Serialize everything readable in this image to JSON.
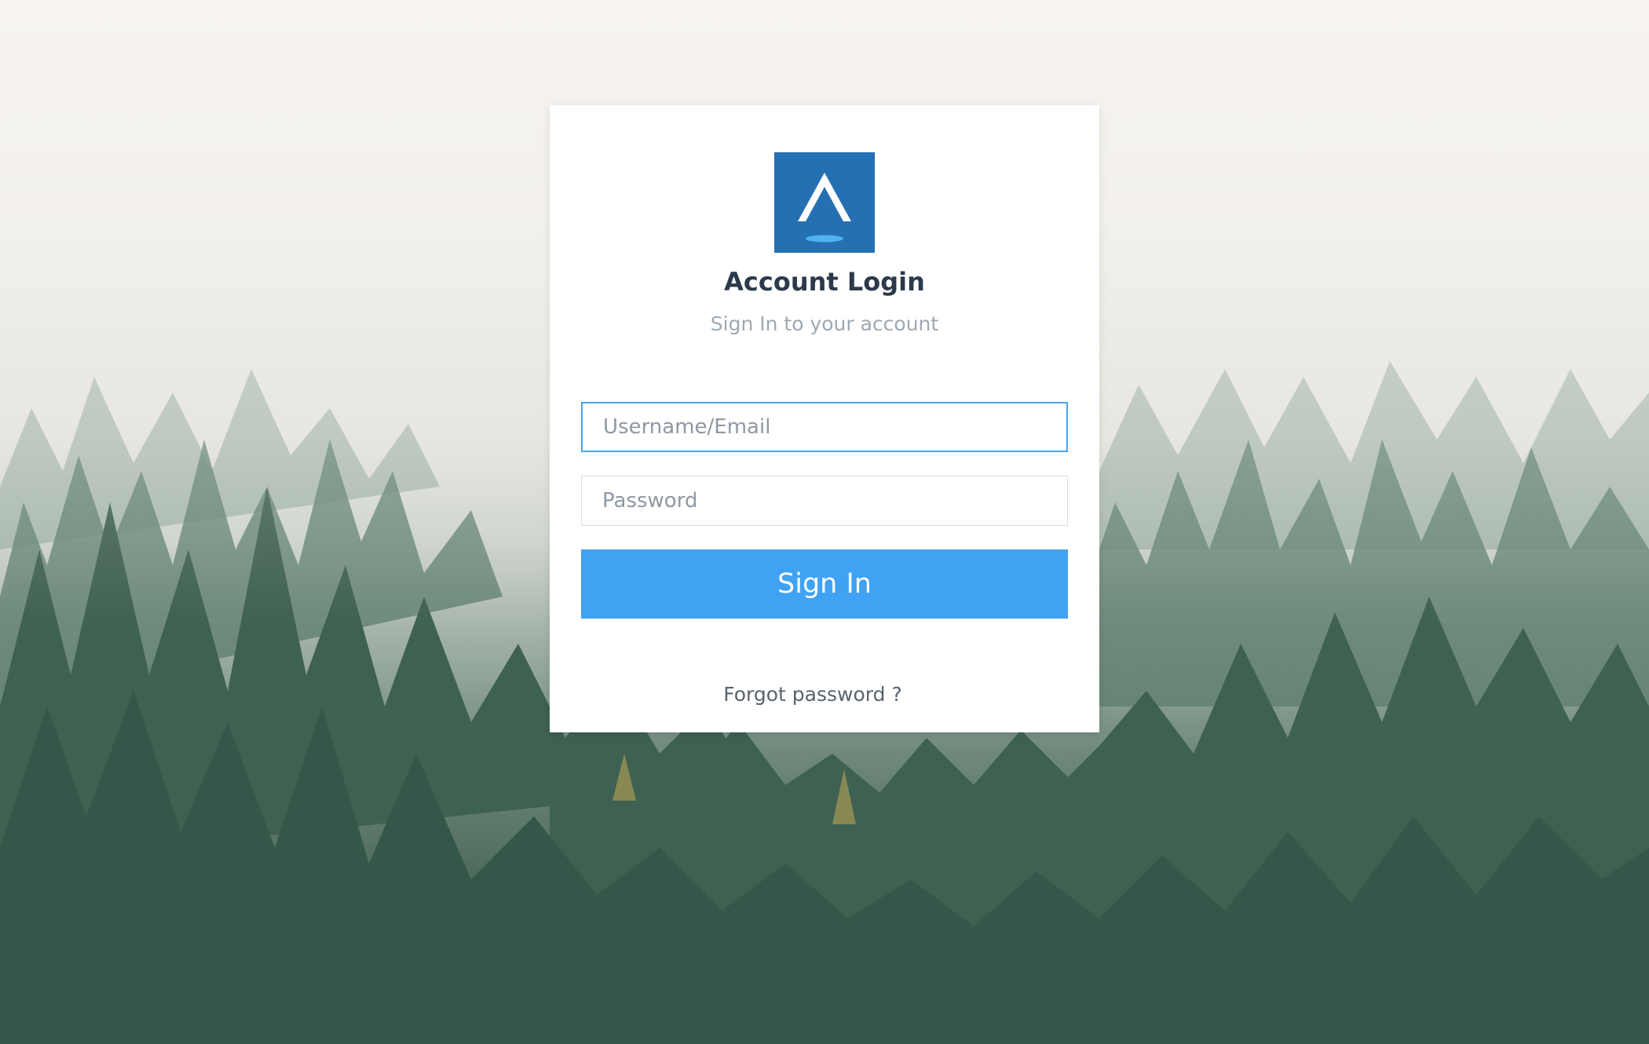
{
  "page": {
    "title": "Account Login",
    "subtitle": "Sign In to your account"
  },
  "form": {
    "username_placeholder": "Username/Email",
    "password_placeholder": "Password",
    "username_value": "",
    "password_value": "",
    "signin_label": "Sign In",
    "forgot_label": "Forgot password ?"
  },
  "colors": {
    "logo": "#2570b3",
    "button": "#40a2f2",
    "focus_border": "#49a3ee"
  },
  "background": {
    "scene": "misty-forest"
  },
  "logo": {
    "icon": "a-logo-icon"
  }
}
